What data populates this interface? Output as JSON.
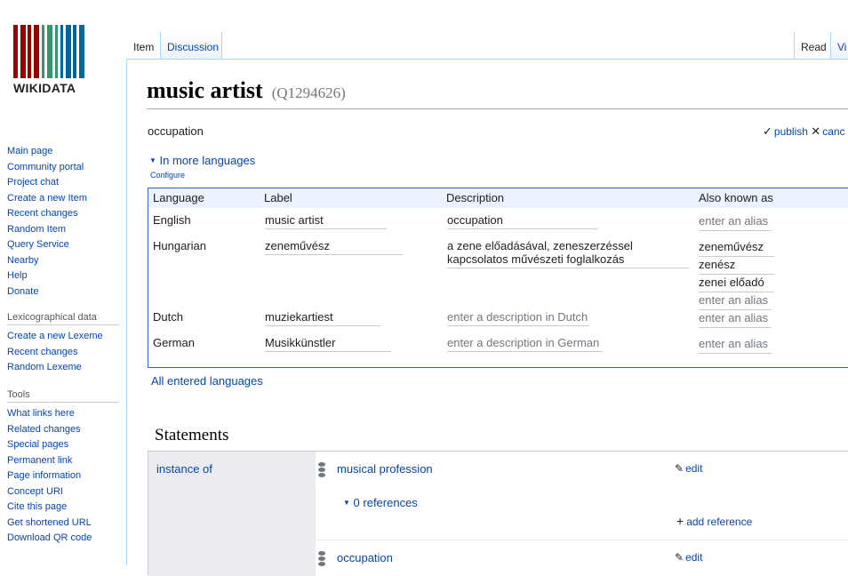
{
  "logo": {
    "text": "WIKIDATA",
    "bar_colors": [
      "#990000",
      "#fff",
      "#990000",
      "#fff",
      "#990000",
      "#fff",
      "#990000",
      "#fff",
      "#339966",
      "#fff",
      "#339966",
      "#fff",
      "#339966",
      "#fff",
      "#006699",
      "#fff",
      "#006699",
      "#fff",
      "#006699",
      "#fff",
      "#006699"
    ]
  },
  "sidebar": {
    "nav": [
      "Main page",
      "Community portal",
      "Project chat",
      "Create a new Item",
      "Recent changes",
      "Random Item",
      "Query Service",
      "Nearby",
      "Help",
      "Donate"
    ],
    "lex_heading": "Lexicographical data",
    "lex": [
      "Create a new Lexeme",
      "Recent changes",
      "Random Lexeme"
    ],
    "tools_heading": "Tools",
    "tools": [
      "What links here",
      "Related changes",
      "Special pages",
      "Permanent link",
      "Page information",
      "Concept URI",
      "Cite this page",
      "Get shortened URL",
      "Download QR code"
    ]
  },
  "tabs": {
    "item": "Item",
    "discussion": "Discussion",
    "read": "Read",
    "view": "Vi"
  },
  "page": {
    "title": "music artist",
    "id": "(Q1294626)"
  },
  "description_input": "occupation",
  "edit": {
    "publish": "publish",
    "cancel": "canc"
  },
  "more_languages": "In more languages",
  "configure": "Configure",
  "lang_table": {
    "headers": {
      "language": "Language",
      "label": "Label",
      "description": "Description",
      "aliases": "Also known as"
    },
    "rows": [
      {
        "language": "English",
        "label": "music artist",
        "description": "occupation",
        "desc_placeholder": false,
        "aliases": [
          "enter an alias"
        ],
        "alias_placeholder": true
      },
      {
        "language": "Hungarian",
        "label": "zeneművész",
        "description": "a zene előadásával, zeneszerzéssel kapcsolatos művészeti foglalkozás",
        "desc_placeholder": false,
        "aliases": [
          "zeneművész",
          "zenész",
          "zenei előadó",
          "enter an alias"
        ],
        "alias_placeholder": false
      },
      {
        "language": "Dutch",
        "label": "muziekartiest",
        "description": "enter a description in Dutch",
        "desc_placeholder": true,
        "aliases": [
          "enter an alias"
        ],
        "alias_placeholder": true
      },
      {
        "language": "German",
        "label": "Musikkünstler",
        "description": "enter a description in German",
        "desc_placeholder": true,
        "aliases": [
          "enter an alias"
        ],
        "alias_placeholder": true
      }
    ]
  },
  "all_languages": "All entered languages",
  "statements": {
    "heading": "Statements",
    "property": "instance of",
    "values": [
      {
        "value": "musical profession",
        "edit": "edit",
        "references": "0 references",
        "add_reference": "add reference"
      },
      {
        "value": "occupation",
        "edit": "edit"
      }
    ]
  }
}
